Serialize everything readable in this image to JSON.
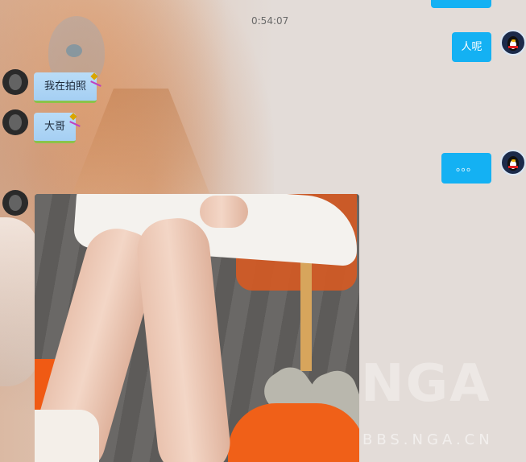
{
  "chat": {
    "timestamp": "0:54:07",
    "messages": [
      {
        "side": "out",
        "text": ""
      },
      {
        "side": "out",
        "text": "人呢"
      },
      {
        "side": "in",
        "text": "我在拍照"
      },
      {
        "side": "in",
        "text": "大哥"
      },
      {
        "side": "out",
        "text": "。。。"
      },
      {
        "side": "in",
        "type": "image",
        "alt": ""
      }
    ]
  },
  "watermark": {
    "logo": "NGA",
    "url": "BBS.NGA.CN"
  },
  "colors": {
    "outgoing_bubble": "#14b1f3",
    "incoming_bubble": "#b9dcf7",
    "background": "#e3dcd8"
  },
  "icons": {
    "self_avatar": "qq-penguin-avatar",
    "peer_avatar": "dark-photo-avatar",
    "bubble_decoration": "kite-icon"
  }
}
